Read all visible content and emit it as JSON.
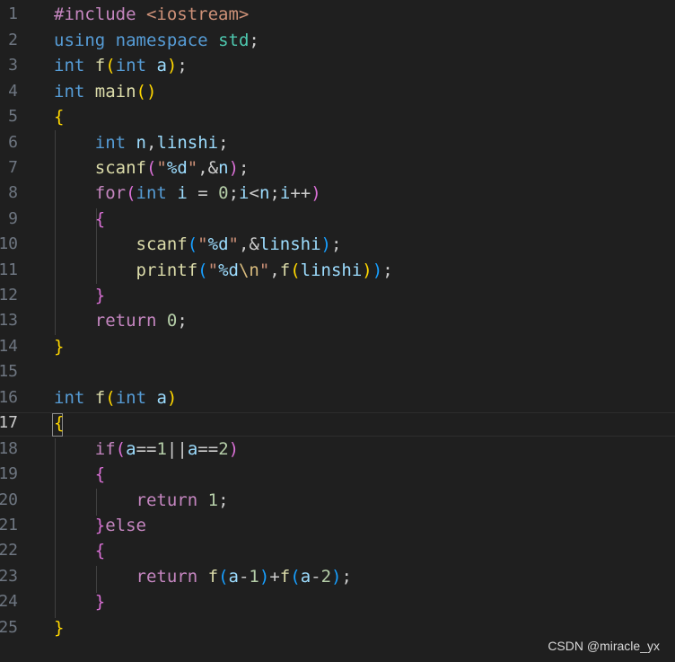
{
  "editor": {
    "language": "C++",
    "current_line": 17,
    "lines": [
      {
        "no": "1",
        "text": "#include <iostream>"
      },
      {
        "no": "2",
        "text": "using namespace std;"
      },
      {
        "no": "3",
        "text": "int f(int a);"
      },
      {
        "no": "4",
        "text": "int main()"
      },
      {
        "no": "5",
        "text": "{"
      },
      {
        "no": "6",
        "text": "    int n,linshi;"
      },
      {
        "no": "7",
        "text": "    scanf(\"%d\",&n);"
      },
      {
        "no": "8",
        "text": "    for(int i = 0;i<n;i++)"
      },
      {
        "no": "9",
        "text": "    {"
      },
      {
        "no": "10",
        "text": "        scanf(\"%d\",&linshi);"
      },
      {
        "no": "11",
        "text": "        printf(\"%d\\n\",f(linshi));"
      },
      {
        "no": "12",
        "text": "    }"
      },
      {
        "no": "13",
        "text": "    return 0;"
      },
      {
        "no": "14",
        "text": "}"
      },
      {
        "no": "15",
        "text": ""
      },
      {
        "no": "16",
        "text": "int f(int a)"
      },
      {
        "no": "17",
        "text": "{"
      },
      {
        "no": "18",
        "text": "    if(a==1||a==2)"
      },
      {
        "no": "19",
        "text": "    {"
      },
      {
        "no": "20",
        "text": "        return 1;"
      },
      {
        "no": "21",
        "text": "    }else"
      },
      {
        "no": "22",
        "text": "    {"
      },
      {
        "no": "23",
        "text": "        return f(a-1)+f(a-2);"
      },
      {
        "no": "24",
        "text": "    }"
      },
      {
        "no": "25",
        "text": "}"
      }
    ]
  },
  "theme": {
    "background": "#1f1f1f",
    "keyword": "#569cd6",
    "control": "#c586c0",
    "function": "#dcdcaa",
    "variable": "#9cdcfe",
    "namespace": "#4ec9b0",
    "number": "#b5cea8",
    "string": "#ce9178",
    "bracket_level_1": "#ffd700",
    "bracket_level_2": "#da70d6",
    "bracket_level_3": "#179fff"
  },
  "watermark": {
    "text": "CSDN @miracle_yx"
  }
}
